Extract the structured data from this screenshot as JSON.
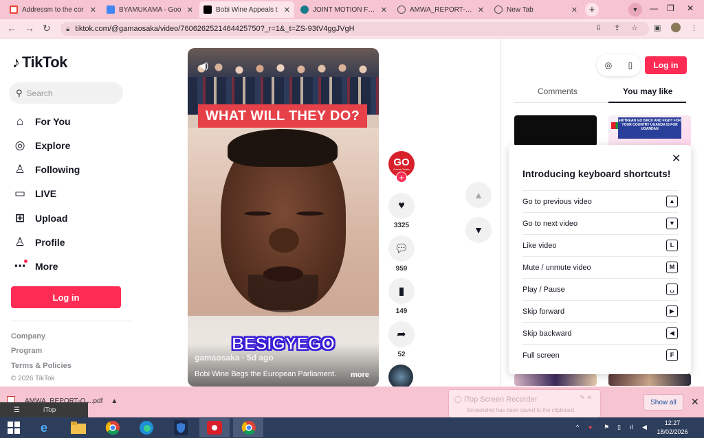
{
  "browser": {
    "tabs": [
      {
        "label": "Addressm to the cor",
        "icon": "gmail-icon",
        "color": "#ea4335"
      },
      {
        "label": "BYAMUKAMA - Goo",
        "icon": "docs-icon",
        "color": "#4285f4"
      },
      {
        "label": "Bobi Wine Appeals t",
        "icon": "tiktok-icon",
        "color": "#000000"
      },
      {
        "label": "JOINT MOTION FOR",
        "icon": "europarl-icon",
        "color": "#1a7a8a"
      },
      {
        "label": "AMWA_REPORT-ON",
        "icon": "globe-icon",
        "color": "#555555"
      },
      {
        "label": "New Tab",
        "icon": "chrome-icon",
        "color": "#555555"
      }
    ],
    "url": "tiktok.com/@gamaosaka/video/7606262521464425750?_r=1&_t=ZS-93tV4ggJVgH"
  },
  "sidebar": {
    "logo": "TikTok",
    "search_placeholder": "Search",
    "nav": [
      {
        "label": "For You",
        "icon": "home-icon"
      },
      {
        "label": "Explore",
        "icon": "compass-icon"
      },
      {
        "label": "Following",
        "icon": "following-icon"
      },
      {
        "label": "LIVE",
        "icon": "live-tv-icon"
      },
      {
        "label": "Upload",
        "icon": "upload-icon"
      },
      {
        "label": "Profile",
        "icon": "profile-icon"
      },
      {
        "label": "More",
        "icon": "more-icon"
      }
    ],
    "login": "Log in",
    "footer": [
      "Company",
      "Program",
      "Terms & Policies"
    ],
    "copyright": "© 2026 TikTok"
  },
  "video": {
    "headline": "WHAT WILL THEY DO?",
    "caption": "BESIGYEGO",
    "author": "gamaosaka · 5d ago",
    "description": "Bobi Wine Begs the European Parliament.",
    "more": "more",
    "avatar_text": "GO",
    "avatar_sub": "Gama Osaka"
  },
  "actions": {
    "likes": "3325",
    "comments": "959",
    "saves": "149",
    "shares": "52"
  },
  "right_panel": {
    "login": "Log in",
    "tabs": [
      "Comments",
      "You may like"
    ],
    "thumb_text": "ERITREAN GO BACK AND FIGHT FOR YOUR COUNTRY UGANDA IS FOR UGANDAN",
    "shortcuts_title": "Introducing keyboard shortcuts!",
    "shortcuts": [
      {
        "label": "Go to previous video",
        "key": "▲"
      },
      {
        "label": "Go to next video",
        "key": "▼"
      },
      {
        "label": "Like video",
        "key": "L"
      },
      {
        "label": "Mute / unmute video",
        "key": "M"
      },
      {
        "label": "Play / Pause",
        "key": "␣"
      },
      {
        "label": "Skip forward",
        "key": "▶"
      },
      {
        "label": "Skip backward",
        "key": "◀"
      },
      {
        "label": "Full screen",
        "key": "F"
      }
    ]
  },
  "downloads": {
    "file": "AMWA_REPORT-O....pdf",
    "show_all": "Show all"
  },
  "toast": {
    "title": "iTop Screen Recorder",
    "subtitle": "Screenshot has been saved to the clipboard.",
    "ghost": "iTop"
  },
  "taskbar": {
    "time": "12:27",
    "date": "18/02/2026"
  }
}
